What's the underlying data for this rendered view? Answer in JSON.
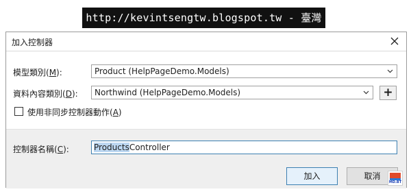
{
  "banner": {
    "text": "http://kevintsengtw.blogspot.tw - 臺灣"
  },
  "dialog": {
    "title": "加入控制器",
    "model_class": {
      "label_pre": "模型類別(",
      "label_key": "M",
      "label_post": "):",
      "value": "Product (HelpPageDemo.Models)"
    },
    "data_context": {
      "label_pre": "資料內容類別(",
      "label_key": "D",
      "label_post": "):",
      "value": "Northwind (HelpPageDemo.Models)",
      "add_label": "+"
    },
    "async_option": {
      "label_pre": "使用非同步控制器動作(",
      "label_key": "A",
      "label_post": ")",
      "checked": false
    },
    "controller_name": {
      "label_pre": "控制器名稱(",
      "label_key": "C",
      "label_post": "):",
      "value_selected": "Products",
      "value_rest": "Controller"
    },
    "buttons": {
      "add": "加入",
      "cancel": "取消"
    }
  },
  "logo": {
    "text": "MD.BT"
  },
  "colors": {
    "selection": "#bcd7f1",
    "focus_border": "#3c7fb1",
    "footer_bg": "#efefef",
    "banner_bg": "#111111"
  },
  "icons": {
    "close": "close-icon",
    "dropdown": "chevron-down-icon"
  }
}
